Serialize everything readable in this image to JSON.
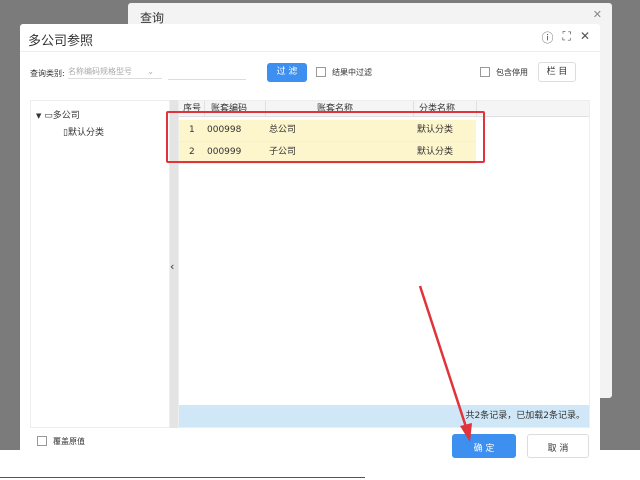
{
  "background_dialog": {
    "title": "查询"
  },
  "dialog": {
    "title": "多公司参照"
  },
  "toolbar": {
    "query_label": "查询类别:",
    "query_placeholder": "名称编码规格型号",
    "filter_button": "过 滤",
    "filter_in_results": "结果中过滤",
    "include_disabled": "包含停用",
    "columns_button": "栏 目"
  },
  "tree": {
    "root": "多公司",
    "child": "默认分类"
  },
  "grid": {
    "columns": [
      "序号",
      "账套编码",
      "账套名称",
      "分类名称"
    ],
    "rows": [
      [
        "1",
        "000998",
        "总公司",
        "默认分类"
      ],
      [
        "2",
        "000999",
        "子公司",
        "默认分类"
      ]
    ],
    "footer": "共2条记录，已加载2条记录。"
  },
  "footer": {
    "overwrite_label": "覆盖原值",
    "ok_button": "确 定",
    "cancel_button": "取 消"
  },
  "colors": {
    "accent": "#3d8ff0",
    "highlight": "#e0343a",
    "row_selected": "#fdf5cc"
  }
}
